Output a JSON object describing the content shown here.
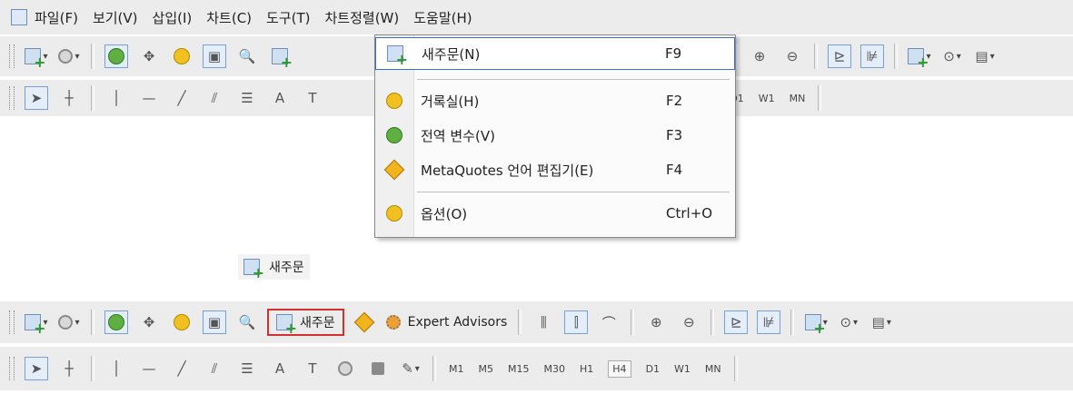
{
  "menubar": {
    "items": [
      {
        "label": "파일(F)"
      },
      {
        "label": "보기(V)"
      },
      {
        "label": "삽입(I)"
      },
      {
        "label": "차트(C)"
      },
      {
        "label": "도구(T)"
      },
      {
        "label": "차트정렬(W)"
      },
      {
        "label": "도움말(H)"
      }
    ]
  },
  "tools_menu": {
    "items": [
      {
        "label": "새주문(N)",
        "shortcut": "F9",
        "icon": "new-order-icon",
        "highlighted": true
      },
      {
        "label": "거록실(H)",
        "shortcut": "F2",
        "icon": "history-icon"
      },
      {
        "label": "전역 변수(V)",
        "shortcut": "F3",
        "icon": "global-variables-icon"
      },
      {
        "label": "MetaQuotes 언어 편집기(E)",
        "shortcut": "F4",
        "icon": "metaeditor-icon"
      },
      {
        "label": "옵션(O)",
        "shortcut": "Ctrl+O",
        "icon": "options-icon"
      }
    ]
  },
  "standalone_button": {
    "label": "새주문"
  },
  "toolbar_standard": {
    "new_order_label": "새주문",
    "expert_advisors_label": "Expert Advisors"
  },
  "timeframes": [
    "M1",
    "M5",
    "M15",
    "M30",
    "H1",
    "H4",
    "D1",
    "W1",
    "MN"
  ],
  "timeframes_partial": [
    "H4",
    "D1",
    "W1",
    "MN"
  ],
  "active_timeframe": "H4",
  "colors": {
    "highlight_border": "#3d6ad0",
    "callout_border": "#d2312f",
    "toolbar_bg": "#ececec"
  }
}
